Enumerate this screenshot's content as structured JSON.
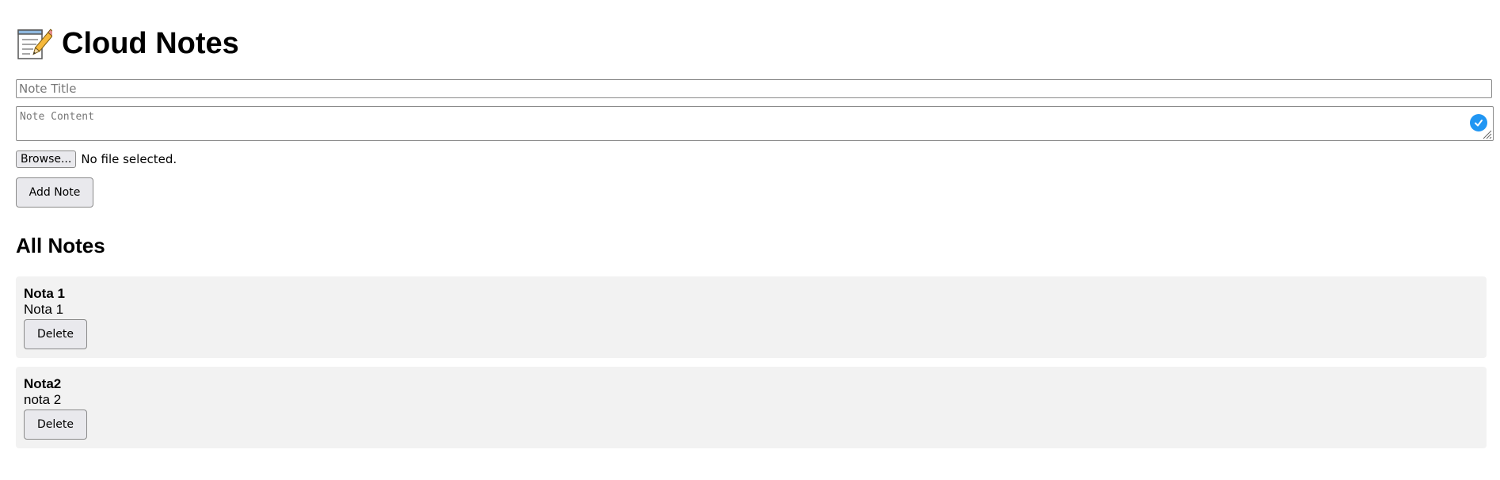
{
  "app": {
    "icon": "memo-icon",
    "title": "Cloud Notes"
  },
  "form": {
    "title_placeholder": "Note Title",
    "title_value": "",
    "content_placeholder": "Note Content",
    "content_value": "",
    "browse_label": "Browse...",
    "file_status": "No file selected.",
    "add_label": "Add Note"
  },
  "list": {
    "heading": "All Notes",
    "notes": [
      {
        "title": "Nota 1",
        "content": "Nota 1",
        "delete_label": "Delete"
      },
      {
        "title": "Nota2",
        "content": "nota 2",
        "delete_label": "Delete"
      }
    ]
  },
  "colors": {
    "card_background": "#f2f2f2",
    "button_background": "#e9e9ed",
    "check_badge": "#2196f3"
  }
}
